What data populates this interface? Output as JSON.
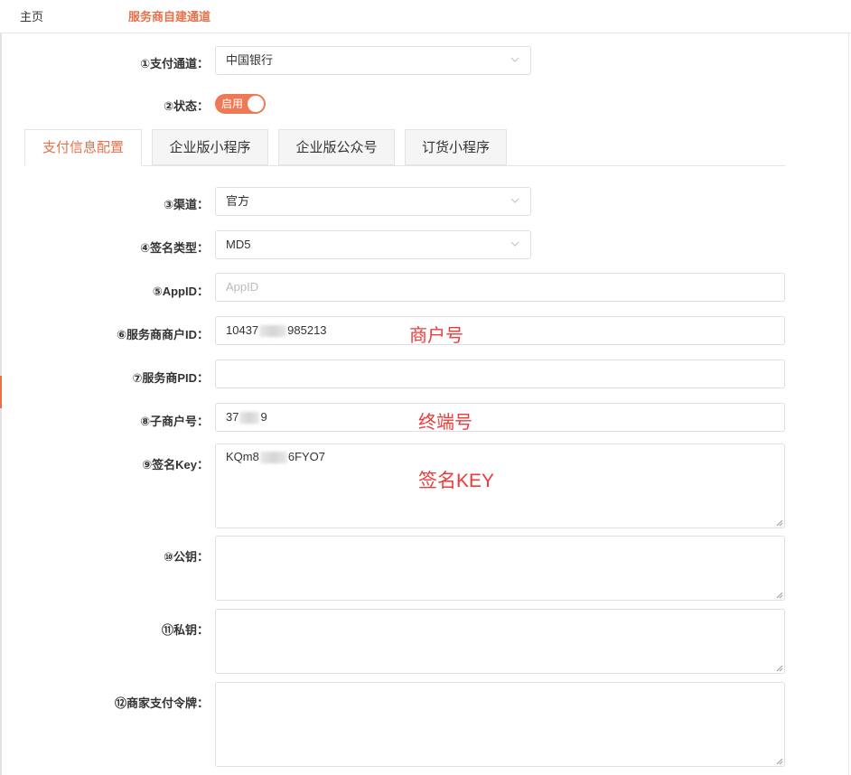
{
  "header": {
    "home_tab": "主页",
    "active_tab": "服务商自建通道"
  },
  "form": {
    "payment_channel": {
      "label": "①支付通道：",
      "value": "中国银行"
    },
    "status": {
      "label": "②状态：",
      "switch_text": "启用",
      "enabled": true
    },
    "tabs": [
      "支付信息配置",
      "企业版小程序",
      "企业版公众号",
      "订货小程序"
    ],
    "active_tab_index": 0,
    "channel": {
      "label": "③渠道：",
      "value": "官方"
    },
    "sign_type": {
      "label": "④签名类型：",
      "value": "MD5"
    },
    "app_id": {
      "label": "⑤AppID：",
      "value": "",
      "placeholder": "AppID"
    },
    "sp_merchant_id": {
      "label": "⑥服务商商户ID：",
      "value_prefix": "10437",
      "value_suffix": "985213"
    },
    "sp_pid": {
      "label": "⑦服务商PID：",
      "value": ""
    },
    "sub_merchant_no": {
      "label": "⑧子商户号：",
      "value_prefix": "37",
      "value_suffix": "9"
    },
    "sign_key": {
      "label": "⑨签名Key：",
      "value_prefix": "KQm8",
      "value_suffix": "6FYO7"
    },
    "public_key": {
      "label": "⑩公钥：",
      "value": ""
    },
    "private_key": {
      "label": "⑪私钥：",
      "value": ""
    },
    "merchant_token": {
      "label": "⑫商家支付令牌：",
      "value": ""
    }
  },
  "annotations": {
    "merchant_no": "商户号",
    "terminal_no": "终端号",
    "sign_key": "签名KEY"
  },
  "colors": {
    "accent": "#e8704a",
    "switch_on": "#ee7a55",
    "annotation": "#f03a3a"
  }
}
